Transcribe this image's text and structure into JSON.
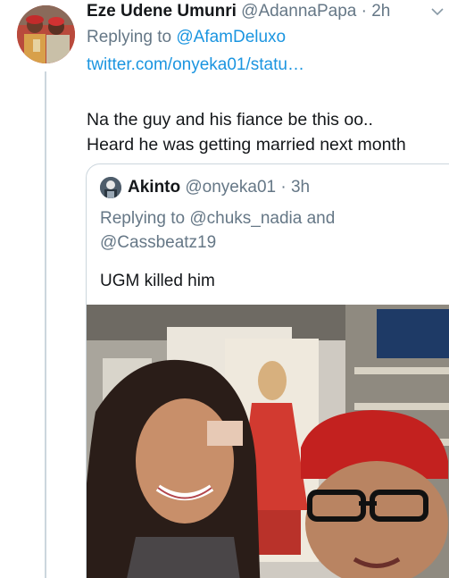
{
  "tweet": {
    "display_name": "Eze Udene Umunri",
    "handle": "@AdannaPapa",
    "separator": "·",
    "time": "2h",
    "reply_prefix": "Replying to ",
    "reply_to": "@AfamDeluxo",
    "link": "twitter.com/onyeka01/statu…",
    "text_lines": [
      "Na the guy and his fiance be this oo..",
      "Heard he was getting married next month"
    ],
    "more_icon": "chevron-down-icon"
  },
  "quoted_tweet": {
    "display_name": "Akinto",
    "handle": "@onyeka01",
    "separator": "·",
    "time": "3h",
    "reply_lines": [
      "Replying to @chuks_nadia and",
      "@Cassbeatz19"
    ],
    "text": "UGM killed him",
    "media": "photo"
  },
  "colors": {
    "text": "#14171a",
    "secondary": "#657786",
    "link": "#1b95e0",
    "border": "#ccd6dd"
  }
}
